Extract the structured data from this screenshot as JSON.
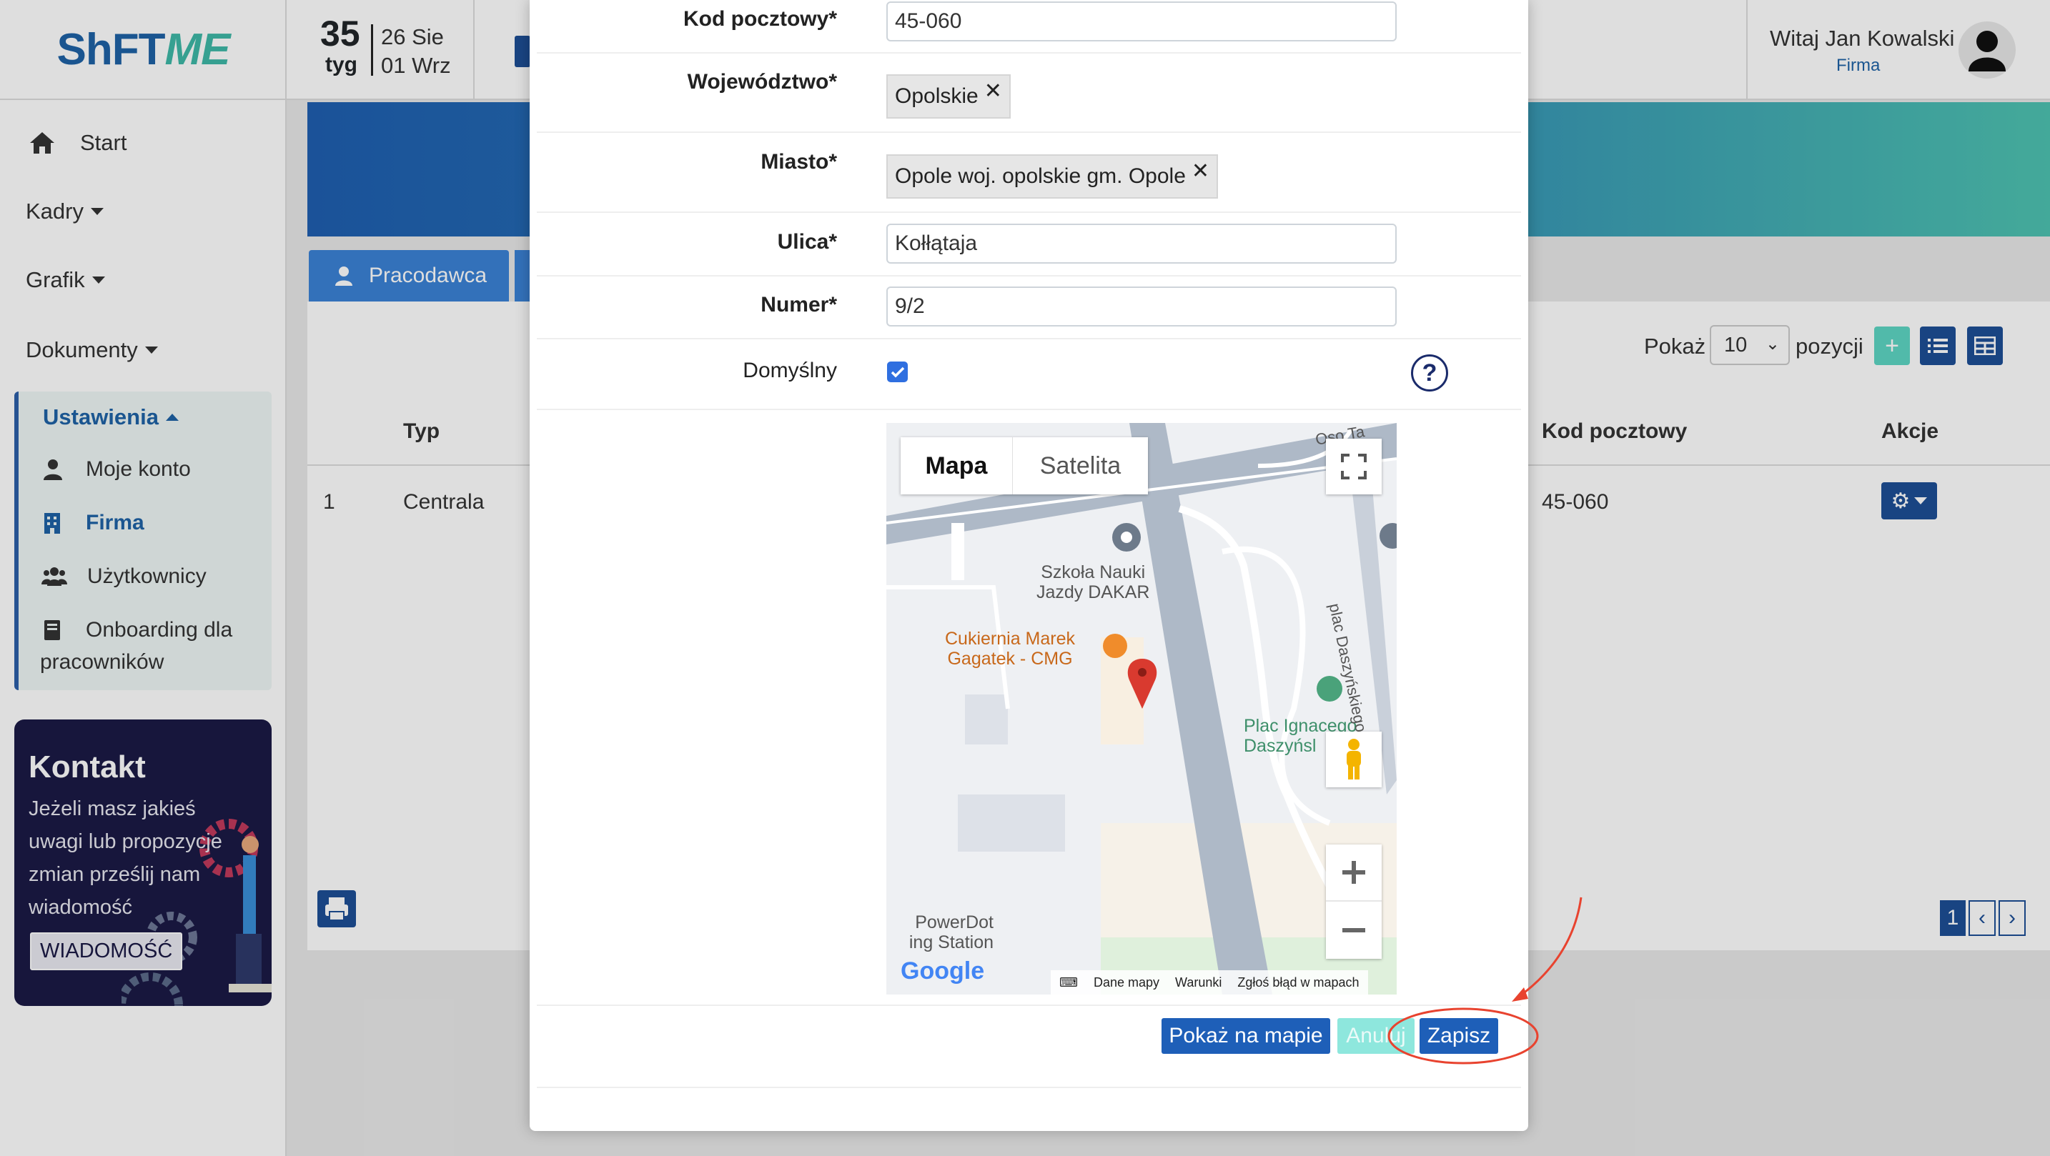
{
  "brand": {
    "logo_part1": "ShFT",
    "logo_part2": "ME"
  },
  "topbar": {
    "week_number": "35",
    "week_label": "tyg",
    "date_start": "26 Sie",
    "date_end": "01 Wrz",
    "greeting": "Witaj Jan Kowalski",
    "company_link": "Firma"
  },
  "sidebar": {
    "start": "Start",
    "kadry": "Kadry",
    "grafik": "Grafik",
    "dokumenty": "Dokumenty",
    "ustawienia": "Ustawienia",
    "sub_items": [
      "Moje konto",
      "Firma",
      "Użytkownicy",
      "Onboarding dla",
      "pracowników"
    ]
  },
  "contact": {
    "title": "Kontakt",
    "text": "Jeżeli masz jakieś uwagi lub propozycje zmian prześlij nam wiadomość",
    "button": "WIADOMOŚĆ"
  },
  "page": {
    "tab_employer": "Pracodawca",
    "show_label": "Pokaż",
    "page_size": "10",
    "positions_label": "pozycji",
    "columns": {
      "typ": "Typ",
      "kod": "Kod pocztowy",
      "akcje": "Akcje"
    },
    "row": {
      "num": "1",
      "typ": "Centrala",
      "kod": "45-060"
    },
    "current_page": "1"
  },
  "form": {
    "postal_label": "Kod pocztowy*",
    "postal_value": "45-060",
    "voivodeship_label": "Województwo*",
    "voivodeship_tag": "Opolskie",
    "city_label": "Miasto*",
    "city_tag": "Opole woj. opolskie gm. Opole",
    "street_label": "Ulica*",
    "street_value": "Kołłątaja",
    "number_label": "Numer*",
    "number_value": "9/2",
    "default_label": "Domyślny",
    "default_checked": true,
    "help": "?"
  },
  "map": {
    "type_map": "Mapa",
    "type_satellite": "Satelita",
    "labels": {
      "school_1": "Szkoła Nauki",
      "school_2": "Jazdy DAKAR",
      "cafe_1": "Cukiernia Marek",
      "cafe_2": "Gagatek - CMG",
      "square_1": "Plac Ignacego",
      "square_2": "Daszyńsl",
      "street_vertical": "plac Daszyńskiego",
      "street_top": "Oso  Ta",
      "station_1": "PowerDot",
      "station_2": "ing Station"
    },
    "google": "Google",
    "footer": [
      "Dane mapy",
      "Warunki",
      "Zgłoś błąd w mapach"
    ]
  },
  "buttons": {
    "show_on_map": "Pokaż na mapie",
    "cancel": "Anuluj",
    "save": "Zapisz"
  },
  "colors": {
    "primary": "#1e5fb8",
    "accent_teal": "#4ec3b1",
    "annotation_red": "#e8432f"
  }
}
